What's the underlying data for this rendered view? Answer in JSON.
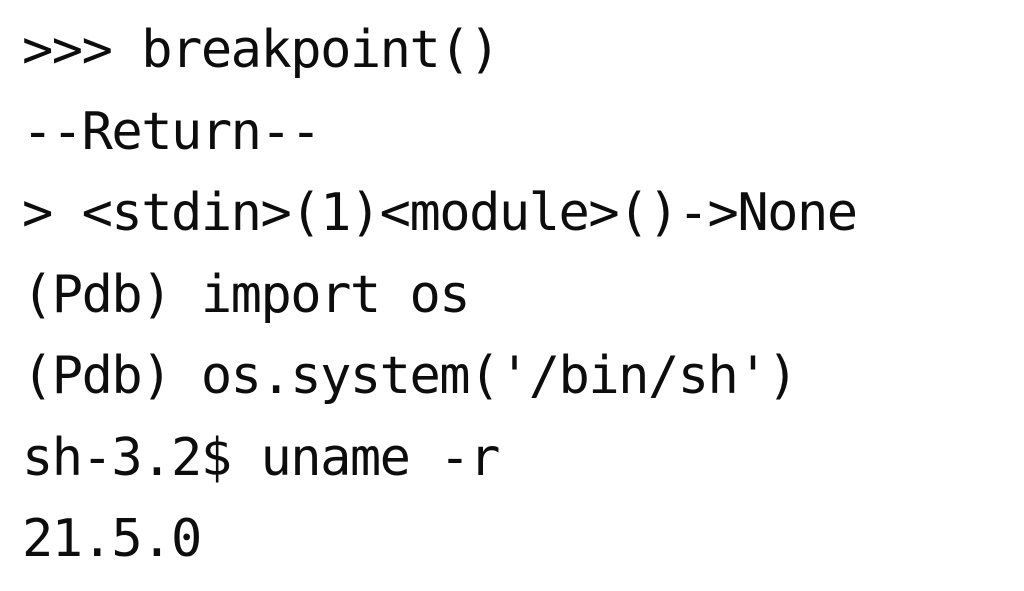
{
  "terminal": {
    "lines": [
      ">>> breakpoint()",
      "--Return--",
      "> <stdin>(1)<module>()->None",
      "(Pdb) import os",
      "(Pdb) os.system('/bin/sh')",
      "sh-3.2$ uname -r",
      "21.5.0"
    ]
  },
  "colors": {
    "background": "#ffffff",
    "text": "#0d0d0d"
  }
}
